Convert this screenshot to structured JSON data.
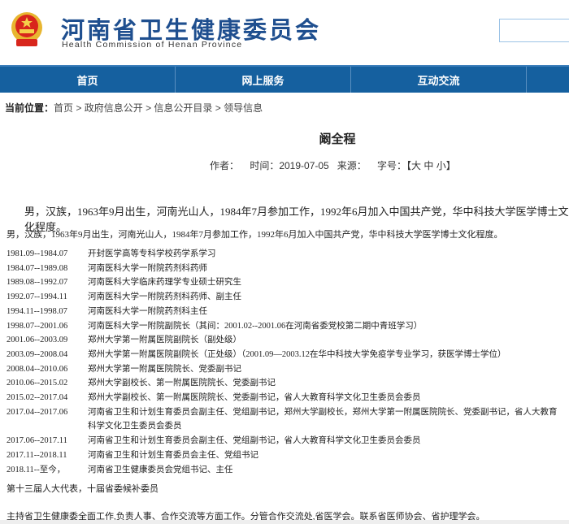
{
  "header": {
    "title": "河南省卫生健康委员会",
    "subtitle": "Health Commission of Henan Province",
    "search_placeholder": ""
  },
  "nav": [
    "首页",
    "网上服务",
    "互动交流"
  ],
  "breadcrumb": {
    "label": "当前位置：",
    "items": [
      "首页",
      "政府信息公开",
      "信息公开目录",
      "领导信息"
    ]
  },
  "article": {
    "title": "阚全程",
    "meta": "作者：    时间：2019-07-05   来源：    字号：【大 中 小】",
    "intro_large": "男，汉族，1963年9月出生，河南光山人，1984年7月参加工作，1992年6月加入中国共产党，华中科技大学医学博士文化程度。",
    "intro_small": "男，汉族，1963年9月出生，河南光山人，1984年7月参加工作，1992年6月加入中国共产党，华中科技大学医学博士文化程度。",
    "resume": [
      {
        "date": "1981.09--1984.07",
        "text": "开封医学高等专科学校药学系学习"
      },
      {
        "date": "1984.07--1989.08",
        "text": "河南医科大学一附院药剂科药师"
      },
      {
        "date": "1989.08--1992.07",
        "text": "河南医科大学临床药理学专业硕士研究生"
      },
      {
        "date": "1992.07--1994.11",
        "text": "河南医科大学一附院药剂科药师、副主任"
      },
      {
        "date": "1994.11--1998.07",
        "text": "河南医科大学一附院药剂科主任"
      },
      {
        "date": "1998.07--2001.06",
        "text": "河南医科大学一附院副院长（其间：2001.02--2001.06在河南省委党校第二期中青班学习）"
      },
      {
        "date": "2001.06--2003.09",
        "text": "郑州大学第一附属医院副院长（副处级）"
      },
      {
        "date": "2003.09--2008.04",
        "text": "郑州大学第一附属医院副院长（正处级）（2001.09—2003.12在华中科技大学免疫学专业学习，获医学博士学位）"
      },
      {
        "date": "2008.04--2010.06",
        "text": "郑州大学第一附属医院院长、党委副书记"
      },
      {
        "date": "2010.06--2015.02",
        "text": "郑州大学副校长、第一附属医院院长、党委副书记"
      },
      {
        "date": "2015.02--2017.04",
        "text": "郑州大学副校长、第一附属医院院长、党委副书记，省人大教育科学文化卫生委员会委员"
      },
      {
        "date": "2017.04--2017.06",
        "text": "河南省卫生和计划生育委员会副主任、党组副书记，郑州大学副校长，郑州大学第一附属医院院长、党委副书记，省人大教育科学文化卫生委员会委员"
      },
      {
        "date": "2017.06--2017.11",
        "text": "河南省卫生和计划生育委员会副主任、党组副书记，省人大教育科学文化卫生委员会委员"
      },
      {
        "date": "2017.11--2018.11",
        "text": "河南省卫生和计划生育委员会主任、党组书记"
      },
      {
        "date": "2018.11--至今，",
        "text": "河南省卫生健康委员会党组书记、主任"
      }
    ],
    "positions": "第十三届人大代表，十届省委候补委员",
    "duties": "主持省卫生健康委全面工作,负责人事、合作交流等方面工作。分管合作交流处,省医学会。联系省医师协会、省护理学会。"
  }
}
